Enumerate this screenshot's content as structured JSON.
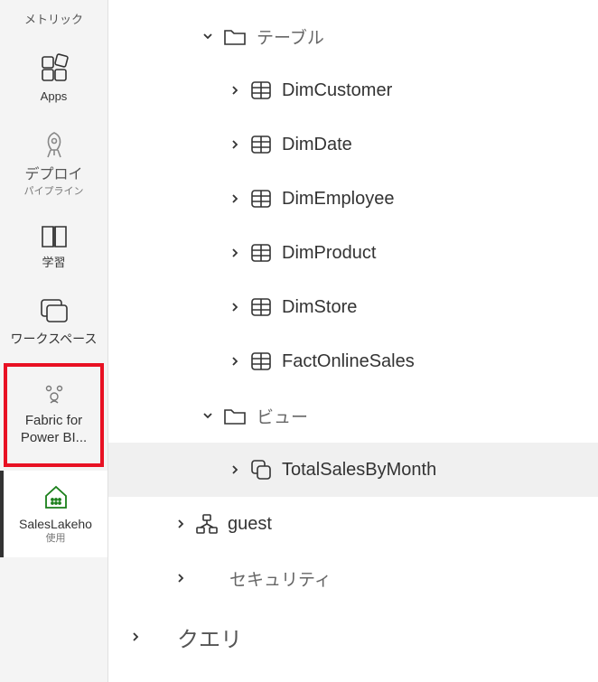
{
  "sidebar": {
    "items": [
      {
        "label": "メトリック"
      },
      {
        "label": "Apps"
      },
      {
        "label": "デプロイ",
        "sub": "パイプライン"
      },
      {
        "label": "学習"
      },
      {
        "label": "ワークスペース"
      },
      {
        "label": "Fabric for Power BI..."
      },
      {
        "label": "SalesLakeho",
        "sub": "使用"
      }
    ]
  },
  "tree": {
    "tables_group": "テーブル",
    "tables": [
      "DimCustomer",
      "DimDate",
      "DimEmployee",
      "DimProduct",
      "DimStore",
      "FactOnlineSales"
    ],
    "views_group": "ビュー",
    "views": [
      "TotalSalesByMonth"
    ],
    "guest": "guest",
    "security": "セキュリティ",
    "query": "クエリ"
  }
}
